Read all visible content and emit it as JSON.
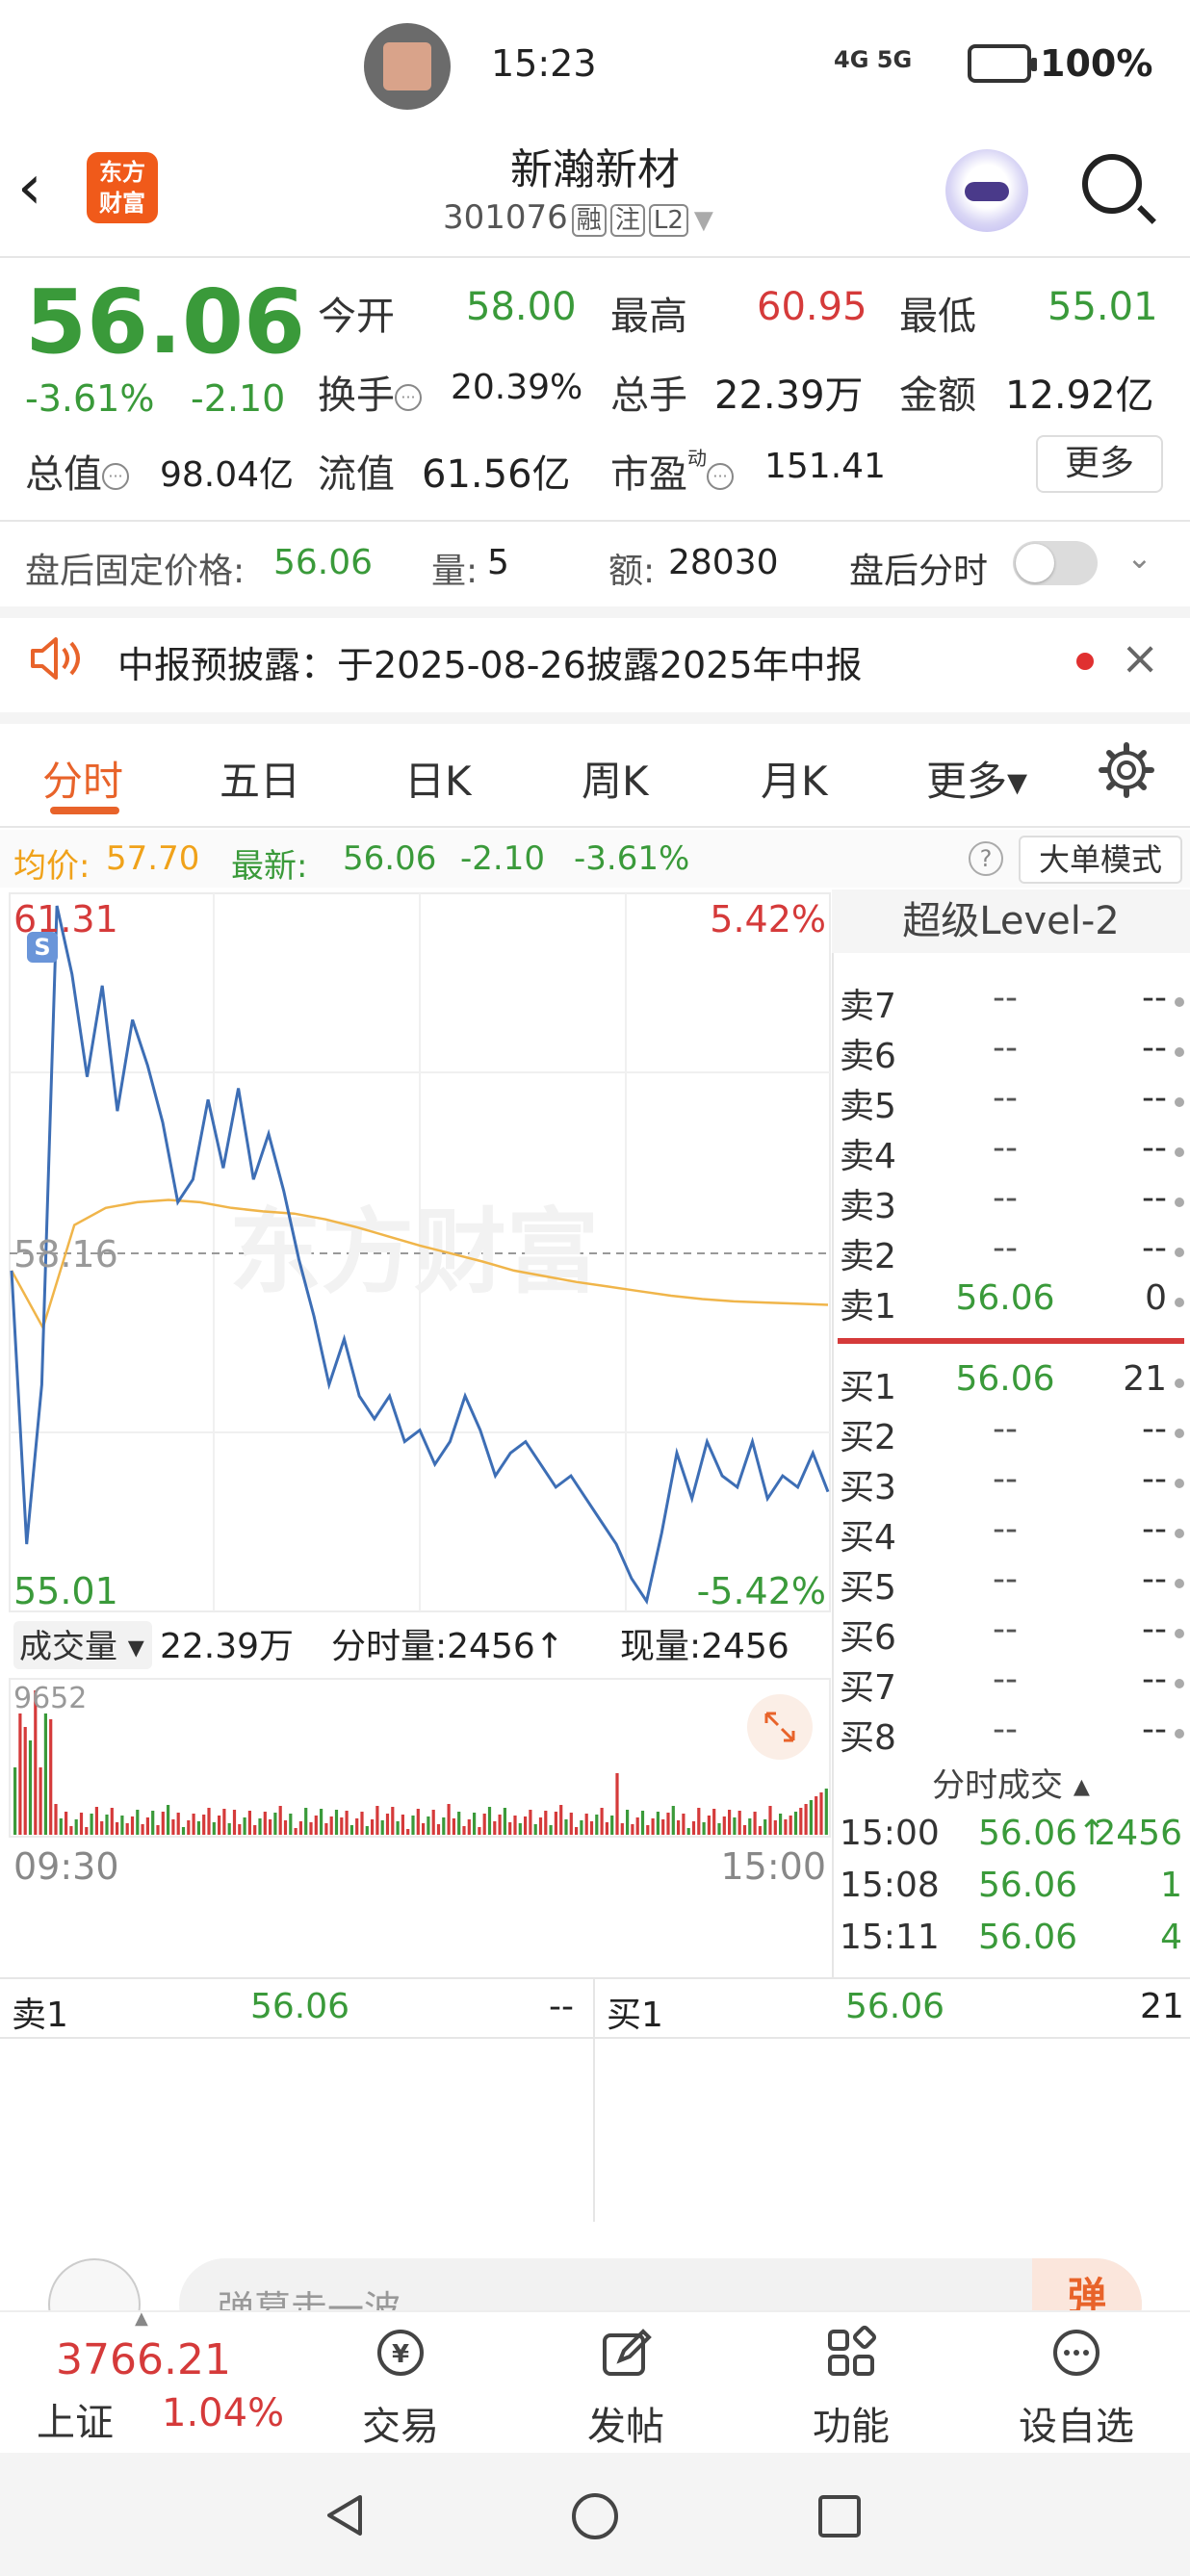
{
  "status_bar": {
    "time": "15:23",
    "network": "4G 5G",
    "battery": "100%"
  },
  "header": {
    "app_logo": "东方财富",
    "stock_name": "新瀚新材",
    "stock_code": "301076",
    "tags": [
      "融",
      "注",
      "L2"
    ]
  },
  "quote": {
    "price": "56.06",
    "pct_change": "-3.61%",
    "abs_change": "-2.10",
    "open_label": "今开",
    "open": "58.00",
    "high_label": "最高",
    "high": "60.95",
    "low_label": "最低",
    "low": "55.01",
    "turnover_label": "换手",
    "turnover": "20.39%",
    "volume_label": "总手",
    "volume": "22.39万",
    "amount_label": "金额",
    "amount": "12.92亿",
    "mktcap_label": "总值",
    "mktcap": "98.04亿",
    "float_label": "流值",
    "float_cap": "61.56亿",
    "pe_label": "市盈",
    "pe_sup": "动",
    "pe": "151.41",
    "more_label": "更多"
  },
  "after_hours": {
    "price_label": "盘后固定价格:",
    "price": "56.06",
    "vol_label": "量:",
    "vol": "5",
    "amt_label": "额:",
    "amt": "28030",
    "timeshare_label": "盘后分时"
  },
  "announcement": {
    "text": "中报预披露：于2025-08-26披露2025年中报"
  },
  "tabs": [
    "分时",
    "五日",
    "日K",
    "周K",
    "月K",
    "更多▾"
  ],
  "avg_row": {
    "avg_label": "均价:",
    "avg": "57.70",
    "latest_label": "最新:",
    "latest": "56.06",
    "chg": "-2.10",
    "pct": "-3.61%",
    "big_order": "大单模式"
  },
  "chart_labels": {
    "top_price": "61.31",
    "top_pct": "5.42%",
    "mid_price": "58.16",
    "bottom_price": "55.01",
    "bottom_pct": "-5.42%",
    "watermark": "东方财富",
    "marker": "S",
    "vol_label": "成交量 ▾",
    "vol_total": "22.39万",
    "vol_tick_label": "分时量:2456↑",
    "vol_now": "现量:2456",
    "vol_max": "9652",
    "time_start": "09:30",
    "time_end": "15:00"
  },
  "chart_data": {
    "type": "line",
    "x_range": [
      "09:30",
      "15:00"
    ],
    "ylim": [
      55.01,
      61.31
    ],
    "reference": 58.16,
    "series": [
      {
        "values": [
          58.0,
          55.6,
          57.0,
          61.2,
          60.6,
          59.7,
          60.5,
          59.4,
          60.2,
          59.8,
          59.3,
          58.6,
          58.8,
          59.5,
          58.9,
          59.6,
          58.8,
          59.2,
          58.7,
          58.1,
          57.6,
          57.0,
          57.4,
          56.9,
          56.7,
          56.9,
          56.5,
          56.6,
          56.3,
          56.5,
          56.9,
          56.6,
          56.2,
          56.4,
          56.5,
          56.3,
          56.1,
          56.2,
          56.0,
          55.8,
          55.6,
          55.3,
          55.1,
          55.7,
          56.4,
          56.0,
          56.5,
          56.2,
          56.1,
          56.5,
          56.0,
          56.2,
          56.1,
          56.4,
          56.06
        ]
      },
      {
        "values": [
          58.0,
          57.5,
          58.4,
          58.55,
          58.6,
          58.62,
          58.6,
          58.55,
          58.52,
          58.5,
          58.45,
          58.38,
          58.3,
          58.22,
          58.15,
          58.08,
          58.0,
          57.95,
          57.9,
          57.86,
          57.82,
          57.78,
          57.75,
          57.73,
          57.72,
          57.71,
          57.7
        ]
      }
    ]
  },
  "level2": {
    "title": "超级Level-2",
    "asks": [
      {
        "label": "卖7",
        "price": "--",
        "vol": "--"
      },
      {
        "label": "卖6",
        "price": "--",
        "vol": "--"
      },
      {
        "label": "卖5",
        "price": "--",
        "vol": "--"
      },
      {
        "label": "卖4",
        "price": "--",
        "vol": "--"
      },
      {
        "label": "卖3",
        "price": "--",
        "vol": "--"
      },
      {
        "label": "卖2",
        "price": "--",
        "vol": "--"
      },
      {
        "label": "卖1",
        "price": "56.06",
        "vol": "0"
      }
    ],
    "bids": [
      {
        "label": "买1",
        "price": "56.06",
        "vol": "21"
      },
      {
        "label": "买2",
        "price": "--",
        "vol": "--"
      },
      {
        "label": "买3",
        "price": "--",
        "vol": "--"
      },
      {
        "label": "买4",
        "price": "--",
        "vol": "--"
      },
      {
        "label": "买5",
        "price": "--",
        "vol": "--"
      },
      {
        "label": "买6",
        "price": "--",
        "vol": "--"
      },
      {
        "label": "买7",
        "price": "--",
        "vol": "--"
      },
      {
        "label": "买8",
        "price": "--",
        "vol": "--"
      }
    ],
    "ticks_title": "分时成交 ▴",
    "ticks": [
      {
        "time": "15:00",
        "price": "56.06↑",
        "vol": "2456"
      },
      {
        "time": "15:08",
        "price": "56.06",
        "vol": "1"
      },
      {
        "time": "15:11",
        "price": "56.06",
        "vol": "4"
      }
    ]
  },
  "order_strip": {
    "ask_label": "卖1",
    "ask_price": "56.06",
    "ask_vol": "--",
    "bid_label": "买1",
    "bid_price": "56.06",
    "bid_vol": "21"
  },
  "comment": {
    "placeholder": "弹幕走一波",
    "button": "弹"
  },
  "bottom_nav": {
    "index_value": "3766.21",
    "index_name": "上证",
    "index_pct": "1.04%",
    "items": [
      "交易",
      "发帖",
      "功能",
      "设自选"
    ]
  },
  "colors": {
    "up": "#d53a3a",
    "down": "#3a9a3a",
    "accent": "#e8632a",
    "price_line": "#3d6eb5",
    "avg_line": "#f0b54a"
  }
}
